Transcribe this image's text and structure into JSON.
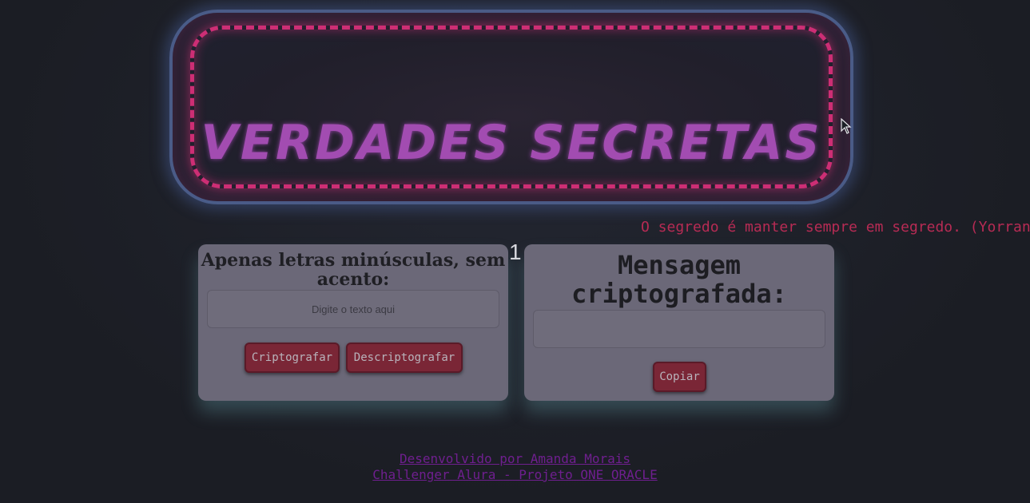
{
  "banner": {
    "title": "VERDADES SECRETAS"
  },
  "marquee": {
    "text": "O segredo é manter sempre em segredo. (Yorrana G"
  },
  "step": {
    "number": "1"
  },
  "input_card": {
    "heading": "Apenas letras minúsculas, sem acento:",
    "input_placeholder": "Digite o texto aqui",
    "input_value": "",
    "encrypt_label": "Criptografar",
    "decrypt_label": "Descriptografar"
  },
  "output_card": {
    "heading": "Mensagem criptografada:",
    "output_value": "",
    "copy_label": "Copiar"
  },
  "footer": {
    "author_link": "Desenvolvido por Amanda Morais",
    "challenge_link": "Challenger Alura - Projeto ONE ORACLE"
  },
  "colors": {
    "background": "#1c1f26",
    "neon_pink": "#eb3282",
    "neon_blue": "#6e8cd2",
    "title_purple": "#a24cb1",
    "card": "#6b6878",
    "button": "#7a2636",
    "marquee": "#b72b54",
    "footer_link": "#6f1f8f"
  },
  "icons": {
    "cursor": "mouse-pointer-icon"
  }
}
